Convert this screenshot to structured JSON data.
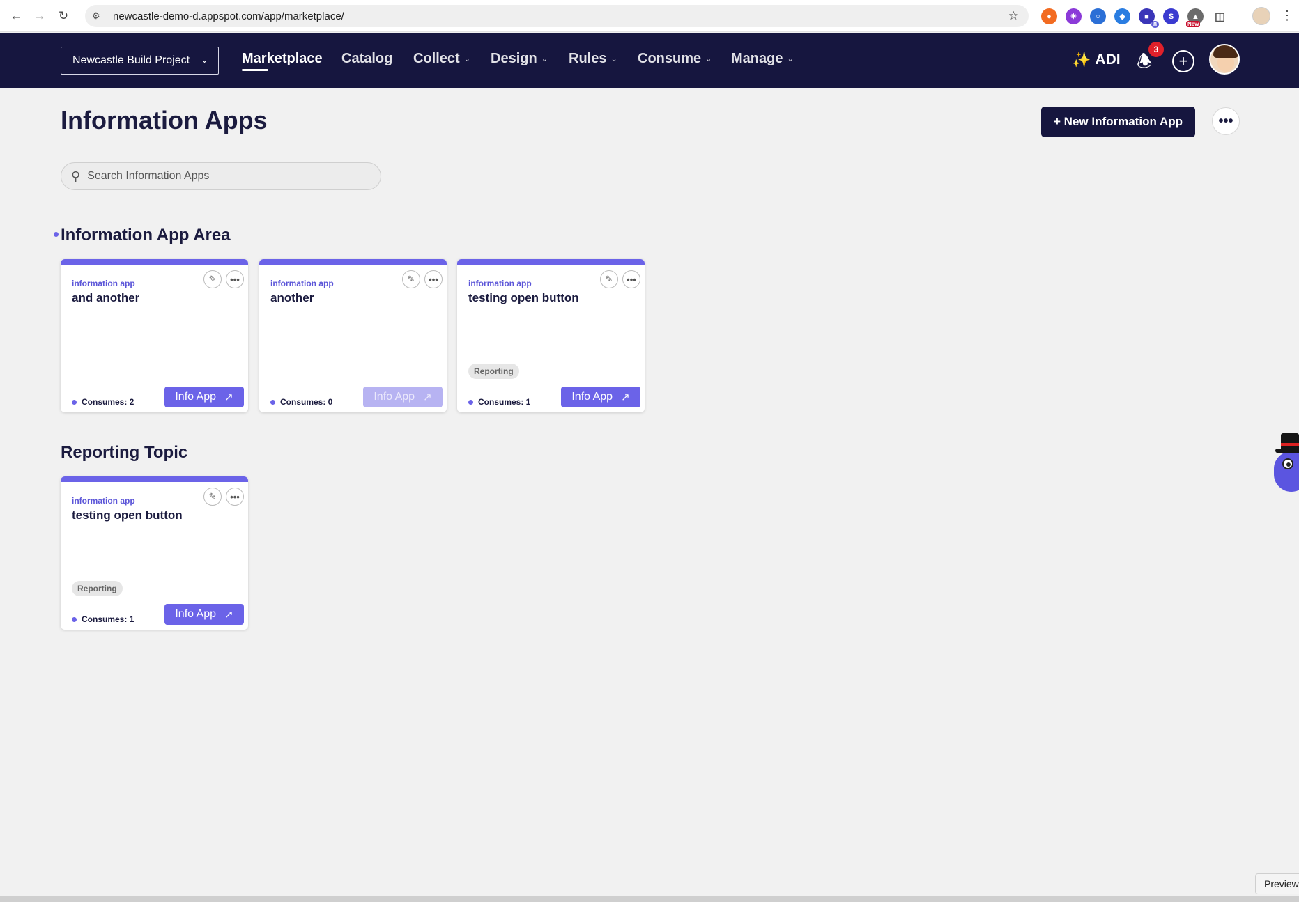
{
  "browser": {
    "url": "newcastle-demo-d.appspot.com/app/marketplace/",
    "extensions": [
      {
        "icon": "orange-extension-icon",
        "color": "#f26b21"
      },
      {
        "icon": "purple-gear-extension-icon",
        "color": "#8b3ad8"
      },
      {
        "icon": "blue-lens-extension-icon",
        "color": "#2b6fd6"
      },
      {
        "icon": "blue-tag-extension-icon",
        "color": "#2a7de1"
      },
      {
        "icon": "indigo-extension-icon",
        "color": "#3a35b8",
        "badge": "8"
      },
      {
        "icon": "s-extension-icon",
        "color": "#3a3ad0",
        "letter": "S"
      },
      {
        "icon": "new-extension-icon",
        "color": "#6b6b6b",
        "badge_new": "New"
      },
      {
        "icon": "puzzle-extension-icon",
        "color": "#5f5f5f"
      }
    ]
  },
  "header": {
    "project": "Newcastle Build Project",
    "nav": [
      {
        "label": "Marketplace",
        "active": true,
        "dropdown": false
      },
      {
        "label": "Catalog",
        "active": false,
        "dropdown": false
      },
      {
        "label": "Collect",
        "active": false,
        "dropdown": true
      },
      {
        "label": "Design",
        "active": false,
        "dropdown": true
      },
      {
        "label": "Rules",
        "active": false,
        "dropdown": true
      },
      {
        "label": "Consume",
        "active": false,
        "dropdown": true
      },
      {
        "label": "Manage",
        "active": false,
        "dropdown": true
      }
    ],
    "adi_label": "ADI",
    "notifications": "3"
  },
  "page": {
    "title": "Information Apps",
    "new_button": "+ New Information App",
    "search_placeholder": "Search Information Apps"
  },
  "sections": [
    {
      "title": "Information App Area",
      "cards": [
        {
          "kind": "information app",
          "title": "and another",
          "tag": "",
          "consumes": "Consumes: 2",
          "button": "Info App",
          "disabled": false
        },
        {
          "kind": "information app",
          "title": "another",
          "tag": "",
          "consumes": "Consumes: 0",
          "button": "Info App",
          "disabled": true
        },
        {
          "kind": "information app",
          "title": "testing open button",
          "tag": "Reporting",
          "consumes": "Consumes: 1",
          "button": "Info App",
          "disabled": false
        }
      ]
    },
    {
      "title": "Reporting Topic",
      "cards": [
        {
          "kind": "information app",
          "title": "testing open button",
          "tag": "Reporting",
          "consumes": "Consumes: 1",
          "button": "Info App",
          "disabled": false
        }
      ]
    }
  ],
  "preview_label": "Preview",
  "colors": {
    "header_bg": "#16163f",
    "accent": "#6b63e8",
    "notification_badge": "#e0202a"
  }
}
